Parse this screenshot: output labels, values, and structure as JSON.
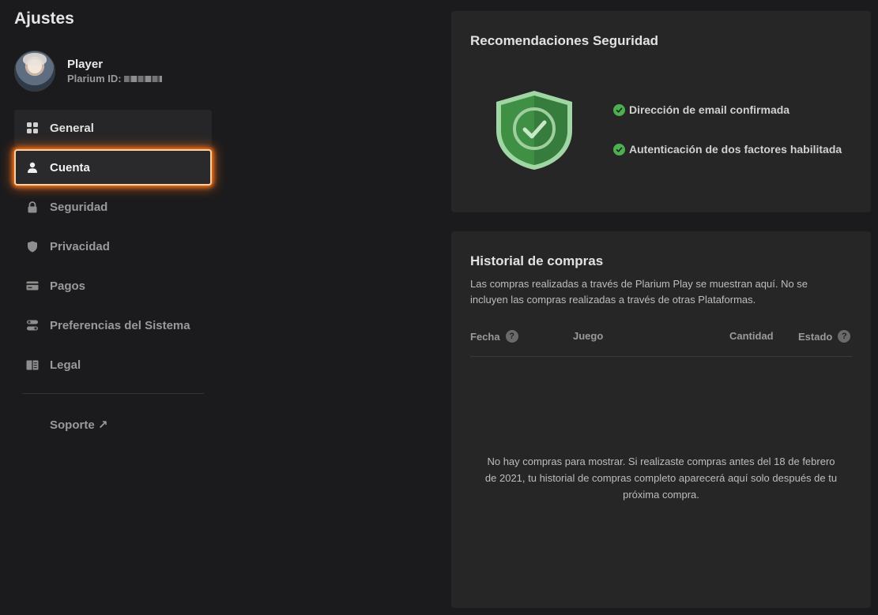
{
  "sidebar": {
    "title": "Ajustes",
    "profile": {
      "name": "Player",
      "id_label": "Plarium ID:"
    },
    "items": [
      {
        "label": "General",
        "icon": "grid-icon"
      },
      {
        "label": "Cuenta",
        "icon": "user-icon"
      },
      {
        "label": "Seguridad",
        "icon": "lock-icon"
      },
      {
        "label": "Privacidad",
        "icon": "shield-icon"
      },
      {
        "label": "Pagos",
        "icon": "card-icon"
      },
      {
        "label": "Preferencias del Sistema",
        "icon": "toggle-icon"
      },
      {
        "label": "Legal",
        "icon": "book-icon"
      }
    ],
    "support": "Soporte ↗"
  },
  "security": {
    "title": "Recomendaciones Seguridad",
    "checks": [
      "Dirección de email confirmada",
      "Autenticación de dos factores habilitada"
    ]
  },
  "history": {
    "title": "Historial de compras",
    "description": "Las compras realizadas a través de Plarium Play se muestran aquí. No se incluyen las compras realizadas a través de otras Plataformas.",
    "columns": {
      "date": "Fecha",
      "game": "Juego",
      "quantity": "Cantidad",
      "status": "Estado"
    },
    "empty": "No hay compras para mostrar. Si realizaste compras antes del 18 de febrero de 2021, tu historial de compras completo aparecerá aquí solo después de tu próxima compra."
  },
  "colors": {
    "accent": "#ff7a1a",
    "success": "#4caf50"
  }
}
